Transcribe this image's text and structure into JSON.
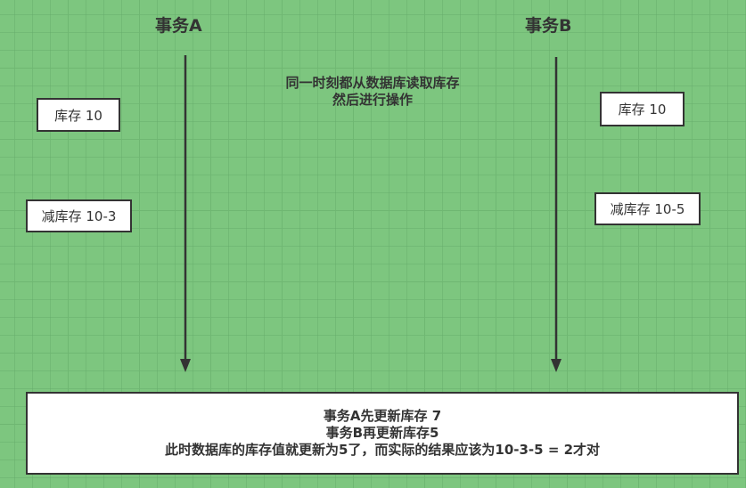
{
  "transaction_a": {
    "title": "事务A",
    "read_box": "库存 10",
    "calc_box": "减库存 10-3"
  },
  "transaction_b": {
    "title": "事务B",
    "read_box": "库存 10",
    "calc_box": "减库存 10-5"
  },
  "middle_note": {
    "line1": "同一时刻都从数据库读取库存",
    "line2": "然后进行操作"
  },
  "result": {
    "line1": "事务A先更新库存 7",
    "line2": "事务B再更新库存5",
    "line3": "此时数据库的库存值就更新为5了，而实际的结果应该为10-3-5 = 2才对"
  }
}
